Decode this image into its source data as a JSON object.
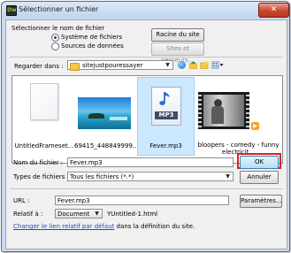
{
  "window": {
    "title": "Sélectionner un fichier",
    "close_label": "✕"
  },
  "source": {
    "heading": "Sélectionner le nom de fichier",
    "options": [
      "Système de fichiers",
      "Sources de données"
    ],
    "selected": "Système de fichiers",
    "site_root_button": "Racine du site",
    "servers_button": "Sites et serveurs..."
  },
  "look_in": {
    "label": "Regarder dans :",
    "value": "sitejustpouressayer"
  },
  "files": [
    {
      "name": "UntitledFrameset...",
      "icon": "blank-document-icon"
    },
    {
      "name": "69415_448849999...",
      "icon": "image-thumbnail-icon"
    },
    {
      "name": "Fever.mp3",
      "icon": "mp3-audio-icon",
      "selected": true
    },
    {
      "name": "bloopers - comedy - funny electricit...",
      "icon": "video-thumbnail-icon"
    }
  ],
  "file_name": {
    "label": "Nom du fichier :",
    "value": "Fever.mp3",
    "ok_button": "OK"
  },
  "file_types": {
    "label": "Types de fichiers :",
    "value": "Tous les fichiers (*.*)",
    "cancel_button": "Annuler"
  },
  "url": {
    "label": "URL :",
    "value": "Fever.mp3",
    "params_button": "Paramètres..."
  },
  "relative": {
    "label": "Relatif à :",
    "value": "Document",
    "doc_name": "YUntitled-1.html"
  },
  "footer": {
    "link_text": "Changer le lien relatif par défaut",
    "rest_text": "dans la définition du site."
  },
  "colors": {
    "ok_highlight": "#d2232a",
    "selection": "#cce8ff",
    "link": "#1c4fbe"
  }
}
